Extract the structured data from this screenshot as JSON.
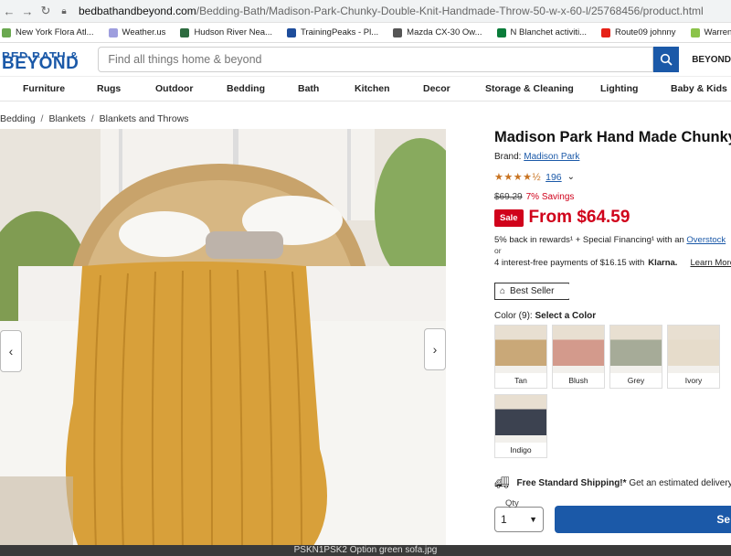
{
  "browser": {
    "url_domain": "bedbathandbeyond.com",
    "url_path": "/Bedding-Bath/Madison-Park-Chunky-Double-Knit-Handmade-Throw-50-w-x-60-l/25768456/product.html"
  },
  "bookmarks": [
    {
      "label": "New York Flora Atl...",
      "color": "#6aa84f"
    },
    {
      "label": "Weather.us",
      "color": "#9e9ede"
    },
    {
      "label": "Hudson River Nea...",
      "color": "#2d6b3f"
    },
    {
      "label": "TrainingPeaks - Pl...",
      "color": "#1e4d9b"
    },
    {
      "label": "Mazda CX-30 Ow...",
      "color": "#555555"
    },
    {
      "label": "N Blanchet activiti...",
      "color": "#0a7c3a"
    },
    {
      "label": "Route09 johnny",
      "color": "#e62117"
    },
    {
      "label": "Warren County Sn...",
      "color": "#8bc34a"
    }
  ],
  "header": {
    "logo_top": "BED BATH &",
    "logo_bottom": "BEYOND",
    "search_placeholder": "Find all things home & beyond",
    "brand_right": "BEYOND"
  },
  "categories": [
    "Furniture",
    "Rugs",
    "Outdoor",
    "Bedding",
    "Bath",
    "Kitchen",
    "Decor",
    "Storage & Cleaning",
    "Lighting",
    "Baby & Kids"
  ],
  "breadcrumb": [
    "Bedding",
    "Blankets",
    "Blankets and Throws"
  ],
  "product": {
    "title": "Madison Park Hand Made Chunky",
    "brand_label": "Brand:",
    "brand": "Madison Park",
    "rating": 4.5,
    "stars": "★★★★½",
    "review_count": "196",
    "old_price": "$69.29",
    "savings": "7% Savings",
    "sale_badge": "Sale",
    "price": "From $64.59",
    "rewards_text": "5% back in rewards¹ + Special Financing¹ with an",
    "rewards_link": "Overstock",
    "or": "or",
    "klarna_text": "4 interest-free payments of $16.15 with",
    "klarna_brand": "Klarna.",
    "learn_more": "Learn More",
    "best_seller": "Best Seller",
    "color_label": "Color (9):",
    "color_prompt": "Select a Color",
    "colors": [
      {
        "name": "Tan",
        "hex": "#c9a878"
      },
      {
        "name": "Blush",
        "hex": "#d39a8c"
      },
      {
        "name": "Grey",
        "hex": "#a6ab98"
      },
      {
        "name": "Ivory",
        "hex": "#e6dccb"
      },
      {
        "name": "Indigo",
        "hex": "#3c4250"
      }
    ],
    "shipping_bold": "Free Standard Shipping!*",
    "shipping_text": "Get an estimated delivery d",
    "qty_label": "Qty",
    "qty_value": "1",
    "add_button": "Se"
  },
  "bottom_strip": "PSKN1PSK2 Option green sofa.jpg",
  "colors": {
    "brand_blue": "#1b59a8",
    "sale_red": "#d0021b",
    "throw_mustard": "#d8a03a"
  }
}
